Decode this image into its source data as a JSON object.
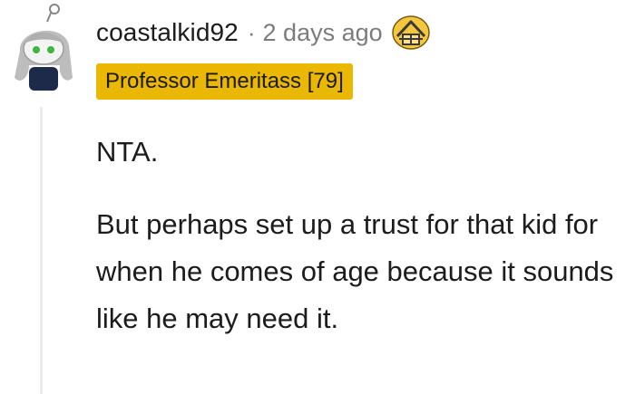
{
  "comment": {
    "author": "coastalkid92",
    "separator": "·",
    "timestamp": "2 days ago",
    "award_icon": "gold-house-award-icon",
    "flair": "Professor Emeritass [79]",
    "paragraphs": [
      "NTA.",
      "But perhaps set up a trust for that kid for when he comes of age because it sounds like he may need it."
    ]
  },
  "colors": {
    "flair_bg": "#eab702",
    "meta_text": "#7c7c7c",
    "body_text": "#1c1c1c",
    "thread_line": "#ececec"
  }
}
